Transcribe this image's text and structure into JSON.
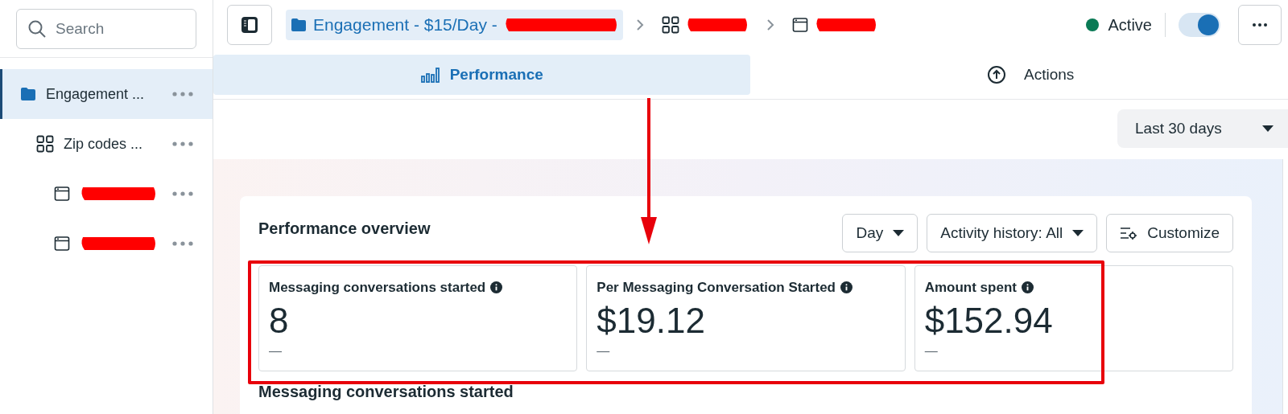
{
  "sidebar": {
    "search": {
      "placeholder": "Search"
    },
    "items": [
      {
        "kind": "campaign",
        "label": "Engagement ...",
        "selected": true,
        "redacted": false,
        "children": [
          {
            "kind": "adset",
            "label": "Zip codes ...",
            "selected": false,
            "redacted": false,
            "children": [
              {
                "kind": "ad",
                "selected": false,
                "redacted": true
              },
              {
                "kind": "ad",
                "selected": false,
                "redacted": true
              }
            ]
          }
        ]
      }
    ]
  },
  "breadcrumbs": [
    {
      "kind": "campaign",
      "label": "Engagement - $15/Day -",
      "redacted": true,
      "selected": true
    },
    {
      "kind": "adset",
      "redacted": true,
      "selected": false
    },
    {
      "kind": "ad",
      "redacted": true,
      "selected": false
    }
  ],
  "status": {
    "label": "Active",
    "color": "#0a7a55",
    "on": true
  },
  "tabs": [
    {
      "kind": "performance",
      "label": "Performance",
      "selected": true
    },
    {
      "kind": "actions",
      "label": "Actions",
      "selected": false
    }
  ],
  "date_range": "Last 30 days",
  "overview": {
    "title": "Performance overview",
    "controls": [
      {
        "kind": "dropdown",
        "label": "Day"
      },
      {
        "kind": "dropdown",
        "label": "Activity history: All"
      },
      {
        "kind": "customize",
        "label": "Customize"
      }
    ],
    "metrics": [
      {
        "label": "Messaging conversations started",
        "value": "8",
        "change": "—"
      },
      {
        "label": "Per Messaging Conversation Started",
        "value": "$19.12",
        "change": "—"
      },
      {
        "label": "Amount spent",
        "value": "$152.94",
        "change": "—"
      }
    ],
    "section_title": "Messaging conversations started"
  }
}
